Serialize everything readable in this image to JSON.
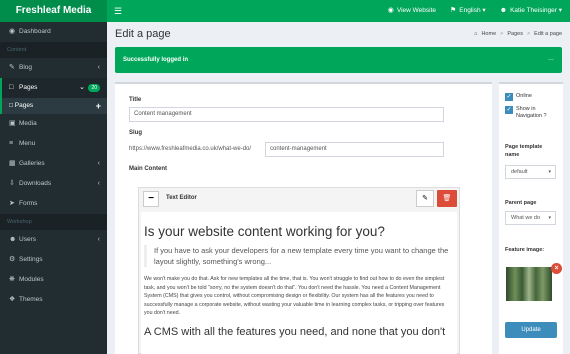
{
  "brand": "Freshleaf Media",
  "topnav": {
    "view_website": "View Website",
    "language": "English",
    "user": "Katie Theisinger"
  },
  "sidebar": {
    "dashboard": "Dashboard",
    "content_head": "Content",
    "blog": "Blog",
    "pages": "Pages",
    "pages_badge": "20",
    "pages_sub": "Pages",
    "media": "Media",
    "menu": "Menu",
    "galleries": "Galleries",
    "downloads": "Downloads",
    "forms": "Forms",
    "workshop_head": "Workshop",
    "users": "Users",
    "settings": "Settings",
    "modules": "Modules",
    "themes": "Themes"
  },
  "header": {
    "title": "Edit a page",
    "crumbs": [
      "Home",
      "Pages",
      "Edit a page"
    ]
  },
  "alert": {
    "text": "Successfully logged in",
    "close": "—"
  },
  "form": {
    "title_label": "Title",
    "title_value": "Content management",
    "slug_label": "Slug",
    "slug_prefix": "https://www.freshleafmedia.co.uk/what-we-do/",
    "slug_value": "content-management",
    "main_label": "Main Content"
  },
  "editor": {
    "collapse": "−",
    "title": "Text Editor",
    "heading": "Is your website content working for you?",
    "quote": "If you have to ask your developers for a new template every time you want to change the layout slightly, something's wrong...",
    "para": "We won't make you do that. Ask for new templates all the time, that is. You won't struggle to find out how to do even the simplest task, and you won't be told \"sorry, no the system doesn't do that\". You don't need the hassle. You need a Content Management System (CMS) that gives you control, without compromising design or flexibility. Our system has all the features you need to successfully manage a corporate website, without wasting your valuable time in learning complex tasks, or tripping over features you don't need.",
    "subheading": "A CMS with all the features you need, and none that you don't"
  },
  "side": {
    "online": "Online",
    "show_nav": "Show in Navigation ?",
    "template_label": "Page template name",
    "template_value": "default",
    "parent_label": "Parent page",
    "parent_value": "What we do",
    "image_label": "Feature image:",
    "update": "Update"
  }
}
